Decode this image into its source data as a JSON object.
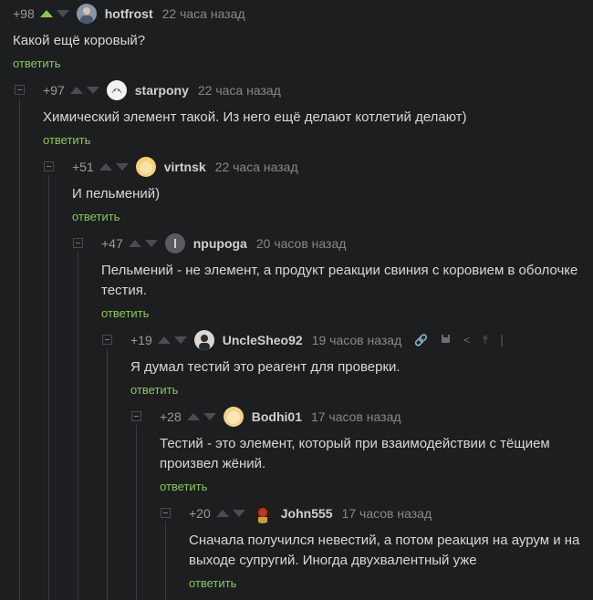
{
  "reply_label": "ответить",
  "colors": {
    "accent": "#8ac858",
    "background": "#1d1e20"
  },
  "comments": [
    {
      "rating": "+98",
      "user": "hotfrost",
      "time": "22 часа назад",
      "text": "Какой ещё коровый?",
      "avatar_icon": "user-avatar-icon"
    },
    {
      "rating": "+97",
      "user": "starpony",
      "time": "22 часа назад",
      "text": "Химический элемент такой. Из него ещё делают котлетий делают)",
      "avatar_icon": "user-avatar-icon"
    },
    {
      "rating": "+51",
      "user": "virtnsk",
      "time": "22 часа назад",
      "text": "И пельмений)",
      "avatar_icon": "user-avatar-icon"
    },
    {
      "rating": "+47",
      "user": "npupoga",
      "time": "20 часов назад",
      "text": "Пельмений - не элемент, а продукт реакции свиния с коровием в оболочке тестия.",
      "avatar_icon": "user-avatar-icon"
    },
    {
      "rating": "+19",
      "user": "UncleSheo92",
      "time": "19 часов назад",
      "text": "Я думал тестий это реагент для проверки.",
      "avatar_icon": "user-avatar-icon"
    },
    {
      "rating": "+28",
      "user": "Bodhi01",
      "time": "17 часов назад",
      "text": "Тестий - это элемент, который при взаимодействии с тёщием произвел жёний.",
      "avatar_icon": "user-avatar-icon"
    },
    {
      "rating": "+20",
      "user": "John555",
      "time": "17 часов назад",
      "text": "Сначала получился невестий, а потом реакция на аурум и на выходе супругий. Иногда двухвалентный уже",
      "avatar_icon": "user-avatar-icon"
    }
  ],
  "tool_icons": [
    "link-icon",
    "save-icon",
    "share-icon",
    "collapse-up-icon",
    "more-icon"
  ]
}
